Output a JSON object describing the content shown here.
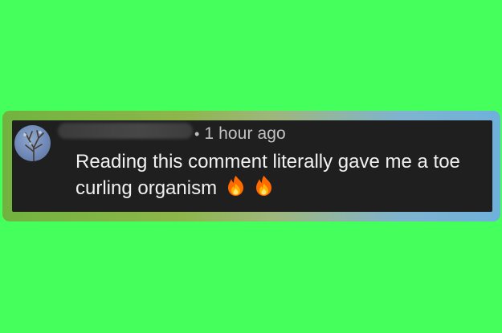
{
  "comment": {
    "timestamp": "1 hour ago",
    "separator": "•",
    "text_line1": "Reading this comment literally gave me a toe",
    "text_line2": "curling organism",
    "emojis": [
      "fire-emoji",
      "fire-emoji"
    ]
  },
  "colors": {
    "background": "#44ff5c",
    "card": "#1f1f1f",
    "text": "#f0f0f0",
    "meta_text": "#c2c2c2",
    "frame_start": "#72b33f",
    "frame_end": "#6fb1dc"
  }
}
